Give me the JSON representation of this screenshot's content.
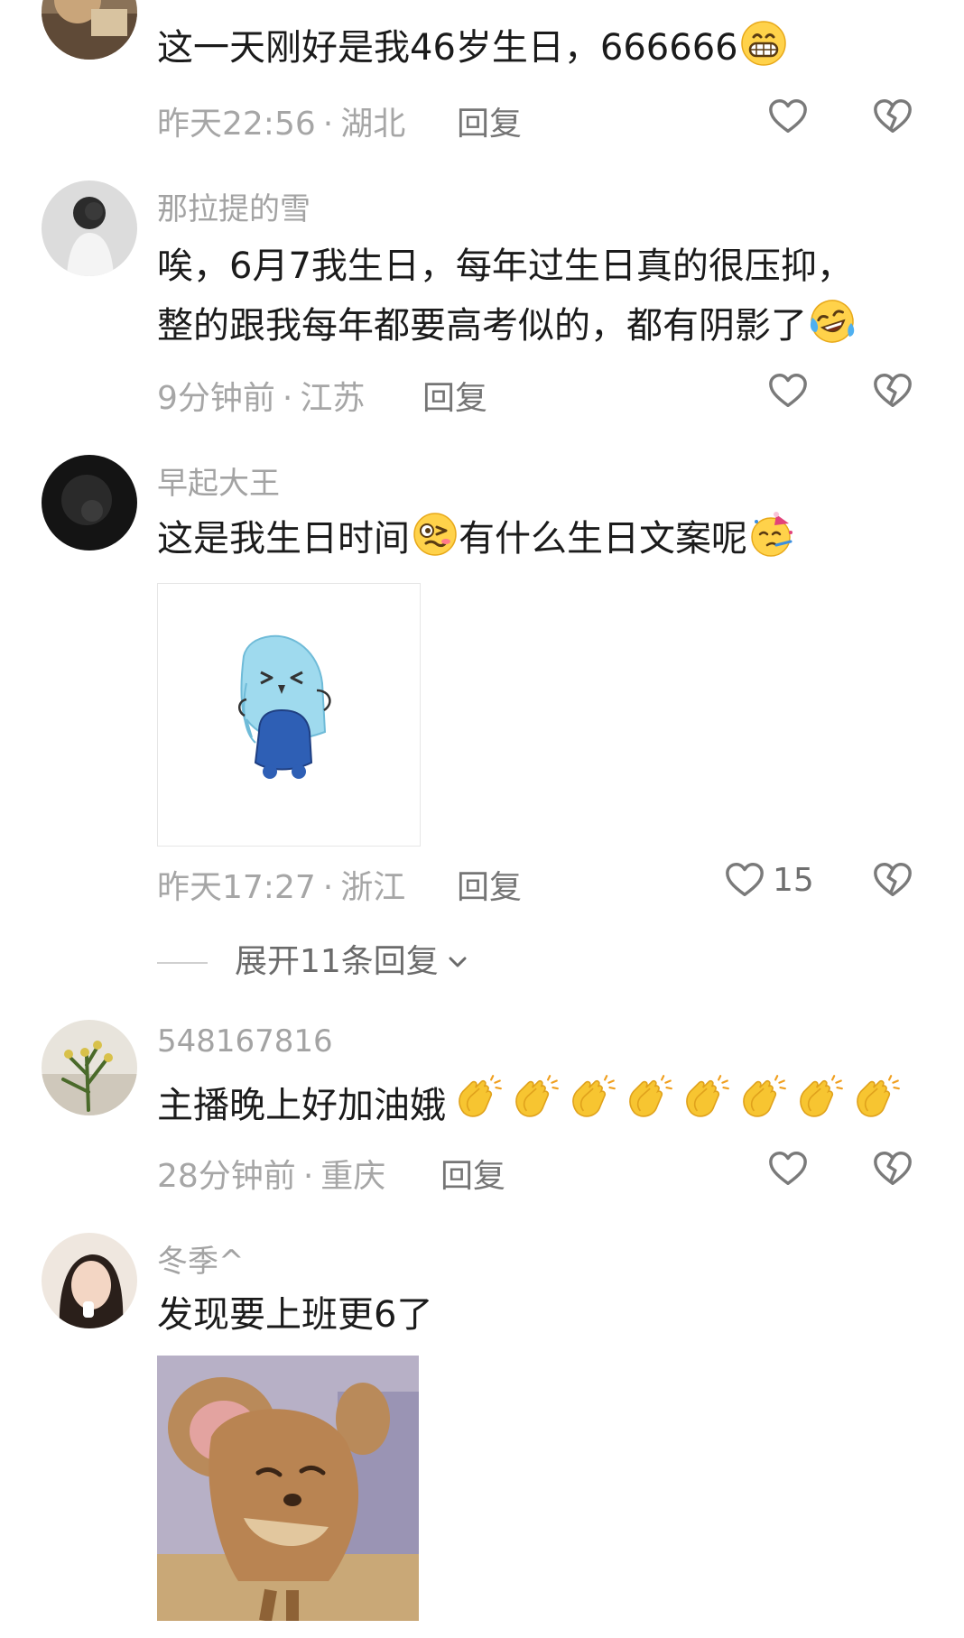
{
  "comments": [
    {
      "text": "这一天刚好是我46岁生日，666666",
      "emoji": "grin-emoji",
      "time": "昨天22:56",
      "location": "湖北",
      "reply": "回复"
    },
    {
      "username": "那拉提的雪",
      "line1": "唉，6月7我生日，每年过生日真的很压抑，",
      "line2": "整的跟我每年都要高考似的，都有阴影了",
      "emoji": "tears-of-joy-emoji",
      "time": "9分钟前",
      "location": "江苏",
      "reply": "回复"
    },
    {
      "username": "早起大王",
      "text1": "这是我生日时间",
      "emoji1": "woozy-face-emoji",
      "text2": "有什么生日文案呢",
      "emoji2": "party-face-emoji",
      "sticker": "blue-hair-anime-chibi-sticker",
      "time": "昨天17:27",
      "location": "浙江",
      "reply": "回复",
      "likes": "15",
      "expand": "展开11条回复"
    },
    {
      "username": "548167816",
      "text": "主播晚上好加油娥",
      "emoji": "clapping-hands-emoji",
      "emoji_count": 8,
      "time": "28分钟前",
      "location": "重庆",
      "reply": "回复"
    },
    {
      "username": "冬季^",
      "text": "发现要上班更6了",
      "sticker": "cartoon-mouse-sticker"
    }
  ],
  "separator": "·",
  "colors": {
    "text": "#1b1b1b",
    "meta": "#a6a6a6",
    "icon": "#7a7a7a",
    "background": "#ffffff"
  }
}
